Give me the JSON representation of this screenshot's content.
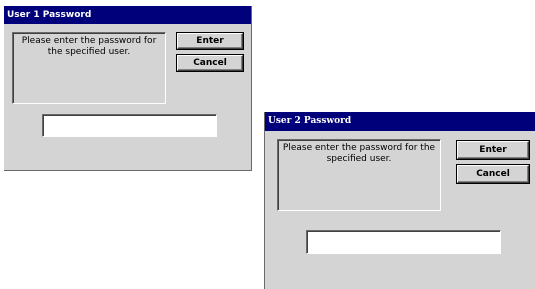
{
  "dialogs": [
    {
      "title": "User 1 Password",
      "message": "Please enter the password for the specified user.",
      "enter_label": "Enter",
      "cancel_label": "Cancel",
      "password_value": ""
    },
    {
      "title": "User 2 Password",
      "message": "Please enter the password for the specified user.",
      "enter_label": "Enter",
      "cancel_label": "Cancel",
      "password_value": ""
    }
  ],
  "colors": {
    "titlebar": "#00007b",
    "dialog_bg": "#d4d4d4",
    "input_bg": "#ffffff"
  }
}
